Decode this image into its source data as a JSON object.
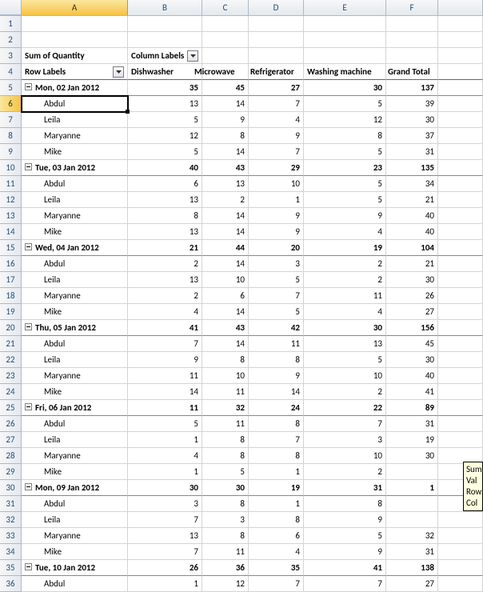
{
  "columns": [
    "A",
    "B",
    "C",
    "D",
    "E",
    "F",
    ""
  ],
  "selected_cell_value": "Abdul",
  "pivot": {
    "measure_label": "Sum of Quantity",
    "column_labels_text": "Column Labels",
    "row_labels_text": "Row Labels",
    "col_headers": [
      "Dishwasher",
      "Microwave",
      "Refrigerator",
      "Washing machine",
      "Grand Total"
    ]
  },
  "rows": [
    {
      "n": 1,
      "type": "blank"
    },
    {
      "n": 2,
      "type": "blank"
    },
    {
      "n": 3,
      "type": "pivotlabels"
    },
    {
      "n": 4,
      "type": "colhdrs"
    },
    {
      "n": 5,
      "type": "group",
      "label": "Mon, 02 Jan 2012",
      "vals": [
        35,
        45,
        27,
        30,
        137
      ]
    },
    {
      "n": 6,
      "type": "detail",
      "label": "Abdul",
      "vals": [
        13,
        14,
        7,
        5,
        39
      ],
      "selected": true
    },
    {
      "n": 7,
      "type": "detail",
      "label": "Leila",
      "vals": [
        5,
        9,
        4,
        12,
        30
      ]
    },
    {
      "n": 8,
      "type": "detail",
      "label": "Maryanne",
      "vals": [
        12,
        8,
        9,
        8,
        37
      ]
    },
    {
      "n": 9,
      "type": "detail",
      "label": "Mike",
      "vals": [
        5,
        14,
        7,
        5,
        31
      ]
    },
    {
      "n": 10,
      "type": "group",
      "label": "Tue, 03 Jan 2012",
      "vals": [
        40,
        43,
        29,
        23,
        135
      ]
    },
    {
      "n": 11,
      "type": "detail",
      "label": "Abdul",
      "vals": [
        6,
        13,
        10,
        5,
        34
      ]
    },
    {
      "n": 12,
      "type": "detail",
      "label": "Leila",
      "vals": [
        13,
        2,
        1,
        5,
        21
      ]
    },
    {
      "n": 13,
      "type": "detail",
      "label": "Maryanne",
      "vals": [
        8,
        14,
        9,
        9,
        40
      ]
    },
    {
      "n": 14,
      "type": "detail",
      "label": "Mike",
      "vals": [
        13,
        14,
        9,
        4,
        40
      ]
    },
    {
      "n": 15,
      "type": "group",
      "label": "Wed, 04 Jan 2012",
      "vals": [
        21,
        44,
        20,
        19,
        104
      ]
    },
    {
      "n": 16,
      "type": "detail",
      "label": "Abdul",
      "vals": [
        2,
        14,
        3,
        2,
        21
      ]
    },
    {
      "n": 17,
      "type": "detail",
      "label": "Leila",
      "vals": [
        13,
        10,
        5,
        2,
        30
      ]
    },
    {
      "n": 18,
      "type": "detail",
      "label": "Maryanne",
      "vals": [
        2,
        6,
        7,
        11,
        26
      ]
    },
    {
      "n": 19,
      "type": "detail",
      "label": "Mike",
      "vals": [
        4,
        14,
        5,
        4,
        27
      ]
    },
    {
      "n": 20,
      "type": "group",
      "label": "Thu, 05 Jan 2012",
      "vals": [
        41,
        43,
        42,
        30,
        156
      ]
    },
    {
      "n": 21,
      "type": "detail",
      "label": "Abdul",
      "vals": [
        7,
        14,
        11,
        13,
        45
      ]
    },
    {
      "n": 22,
      "type": "detail",
      "label": "Leila",
      "vals": [
        9,
        8,
        8,
        5,
        30
      ]
    },
    {
      "n": 23,
      "type": "detail",
      "label": "Maryanne",
      "vals": [
        11,
        10,
        9,
        10,
        40
      ]
    },
    {
      "n": 24,
      "type": "detail",
      "label": "Mike",
      "vals": [
        14,
        11,
        14,
        2,
        41
      ]
    },
    {
      "n": 25,
      "type": "group",
      "label": "Fri, 06 Jan 2012",
      "vals": [
        11,
        32,
        24,
        22,
        89
      ]
    },
    {
      "n": 26,
      "type": "detail",
      "label": "Abdul",
      "vals": [
        5,
        11,
        8,
        7,
        31
      ]
    },
    {
      "n": 27,
      "type": "detail",
      "label": "Leila",
      "vals": [
        1,
        8,
        7,
        3,
        19
      ]
    },
    {
      "n": 28,
      "type": "detail",
      "label": "Maryanne",
      "vals": [
        4,
        8,
        8,
        10,
        30
      ]
    },
    {
      "n": 29,
      "type": "detail",
      "label": "Mike",
      "vals": [
        1,
        5,
        1,
        2,
        ""
      ]
    },
    {
      "n": 30,
      "type": "group",
      "label": "Mon, 09 Jan 2012",
      "vals": [
        30,
        30,
        19,
        31,
        "1"
      ]
    },
    {
      "n": 31,
      "type": "detail",
      "label": "Abdul",
      "vals": [
        3,
        8,
        1,
        8,
        ""
      ]
    },
    {
      "n": 32,
      "type": "detail",
      "label": "Leila",
      "vals": [
        7,
        3,
        8,
        9,
        ""
      ]
    },
    {
      "n": 33,
      "type": "detail",
      "label": "Maryanne",
      "vals": [
        13,
        8,
        6,
        5,
        32
      ]
    },
    {
      "n": 34,
      "type": "detail",
      "label": "Mike",
      "vals": [
        7,
        11,
        4,
        9,
        31
      ]
    },
    {
      "n": 35,
      "type": "group",
      "label": "Tue, 10 Jan 2012",
      "vals": [
        26,
        36,
        35,
        41,
        138
      ]
    },
    {
      "n": 36,
      "type": "detail",
      "label": "Abdul",
      "vals": [
        1,
        12,
        7,
        7,
        27
      ]
    }
  ],
  "tooltip": [
    "Sum",
    "Val",
    "Row",
    "Col"
  ]
}
